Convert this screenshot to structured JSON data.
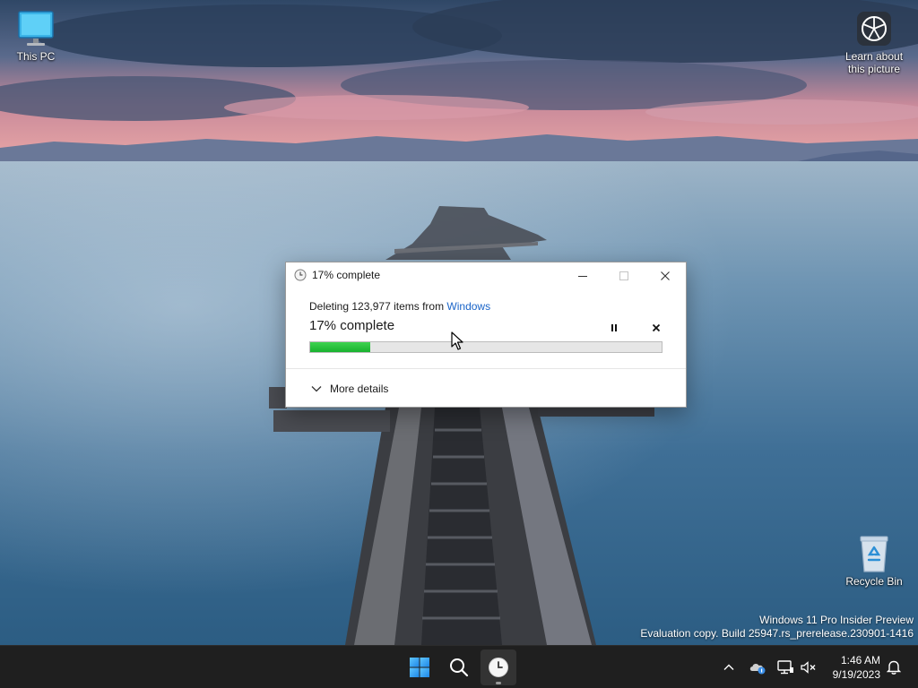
{
  "desktop": {
    "icons": [
      {
        "label": "This PC",
        "icon": "monitor-icon"
      },
      {
        "label": "Recycle Bin",
        "icon": "recycle-bin-icon"
      }
    ],
    "spotlight": {
      "label_line1": "Learn about",
      "label_line2": "this picture",
      "icon": "camera-icon"
    },
    "watermark": {
      "line1": "Windows 11 Pro Insider Preview",
      "line2": "Evaluation copy. Build 25947.rs_prerelease.230901-1416"
    }
  },
  "dialog": {
    "title": "17% complete",
    "title_icon": "clock-icon",
    "status_prefix": "Deleting 123,977 items from ",
    "status_link": "Windows",
    "progress_text": "17% complete",
    "progress_fraction": 0.17,
    "more_details_label": "More details",
    "buttons": {
      "minimize": "minimize-icon",
      "maximize": "maximize-icon",
      "close": "close-icon"
    },
    "controls": {
      "pause": "pause-icon",
      "cancel": "cancel-icon"
    }
  },
  "taskbar": {
    "apps": [
      {
        "name": "start-button",
        "icon": "windows-logo-icon"
      },
      {
        "name": "search-button",
        "icon": "search-icon"
      },
      {
        "name": "file-operation-app",
        "icon": "clock-icon",
        "active": true
      }
    ],
    "tray": {
      "icons": [
        "chevron-up-icon",
        "onedrive-icon",
        "network-icon",
        "volume-muted-icon"
      ],
      "time": "1:46 AM",
      "date": "9/19/2023",
      "notification_icon": "bell-icon"
    }
  },
  "colors": {
    "progress_green": "#22c33a",
    "link_blue": "#1a64c8",
    "taskbar": "#1f1f1f"
  }
}
